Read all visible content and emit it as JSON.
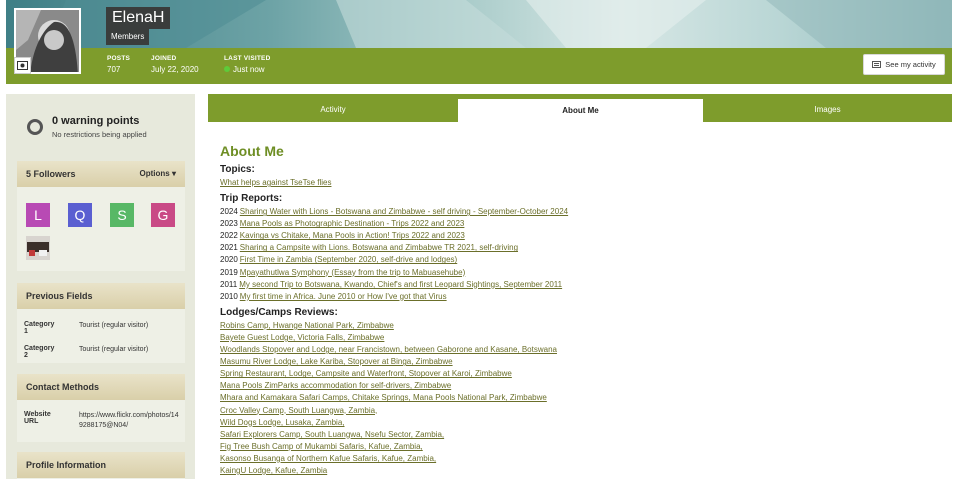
{
  "profile": {
    "name": "ElenaH",
    "group": "Members",
    "stats": [
      {
        "label": "POSTS",
        "value": "707"
      },
      {
        "label": "JOINED",
        "value": "July 22, 2020"
      },
      {
        "label": "LAST VISITED",
        "value": "Just now"
      }
    ],
    "activity_button": "See my activity"
  },
  "sidebar": {
    "warning_title": "0 warning points",
    "warning_sub": "No restrictions being applied",
    "followers_title": "5 Followers",
    "options_label": "Options",
    "followers": [
      {
        "letter": "L",
        "color": "#b84ab4"
      },
      {
        "letter": "Q",
        "color": "#5a5fd1"
      },
      {
        "letter": "S",
        "color": "#58b866"
      },
      {
        "letter": "G",
        "color": "#c94a86"
      }
    ],
    "previous_fields_title": "Previous Fields",
    "fields": [
      {
        "key": "Category 1",
        "value": "Tourist (regular visitor)"
      },
      {
        "key": "Category 2",
        "value": "Tourist (regular visitor)"
      }
    ],
    "contact_title": "Contact Methods",
    "website_label": "Website URL",
    "website_value": "https://www.flickr.com/photos/149288175@N04/",
    "profile_info_title": "Profile Information"
  },
  "tabs": [
    {
      "label": "Activity"
    },
    {
      "label": "About Me"
    },
    {
      "label": "Images"
    }
  ],
  "about": {
    "heading": "About Me",
    "topics_title": "Topics:",
    "topics": [
      "What helps against TseTse flies"
    ],
    "trips_title": "Trip Reports:",
    "trips": [
      {
        "year": "2024",
        "title": "Sharing Water with Lions - Botswana and Zimbabwe - self driving - September-October 2024"
      },
      {
        "year": "2023",
        "title": "Mana Pools as Photographic Destination - Trips 2022 and 2023"
      },
      {
        "year": "2022",
        "title": "Kavinga vs Chitake, Mana Pools in Action! Trips 2022 and 2023"
      },
      {
        "year": "2021",
        "title": "Sharing a Campsite with Lions. Botswana and Zimbabwe TR 2021, self-driving"
      },
      {
        "year": "2020",
        "title": "First Time in Zambia (September 2020, self-drive and lodges)"
      },
      {
        "year": "2019",
        "title": "Mpayathutlwa Symphony (Essay from the trip to Mabuasehube)"
      },
      {
        "year": "2011",
        "title": "My second Trip to Botswana, Kwando, Chief's and first Leopard Sightings, September 2011"
      },
      {
        "year": "2010",
        "title": "My first time in Africa. June 2010 or How I've got that Virus"
      }
    ],
    "lodges_title": "Lodges/Camps Reviews:",
    "lodges": [
      "Robins Camp, Hwange National Park, Zimbabwe",
      "Bayete Guest Lodge, Victoria Falls, Zimbabwe",
      "Woodlands Stopover and Lodge, near Francistown, between Gaborone and Kasane, Botswana",
      "Masumu River Lodge, Lake Kariba, Stopover at Binga, Zimbabwe",
      "Spring Restaurant, Lodge, Campsite and Waterfront, Stopover at Karoi, Zimbabwe",
      "Mana Pools ZimParks accommodation for self-drivers, Zimbabwe",
      "Mhara and Kamakara Safari Camps, Chitake Springs, Mana Pools National Park, Zimbabwe",
      "Croc Valley Camp, South Luangwa, Zambia,",
      "Wild Dogs Lodge, Lusaka, Zambia,",
      "Safari Explorers Camp, South Luangwa, Nsefu Sector, Zambia,",
      "Fig Tree Bush Camp of Mukambi Safaris, Kafue, Zambia,",
      "Kasonso Busanga of Northern Kafue Safaris, Kafue, Zambia,",
      "KaingU Lodge, Kafue, Zambia"
    ]
  }
}
